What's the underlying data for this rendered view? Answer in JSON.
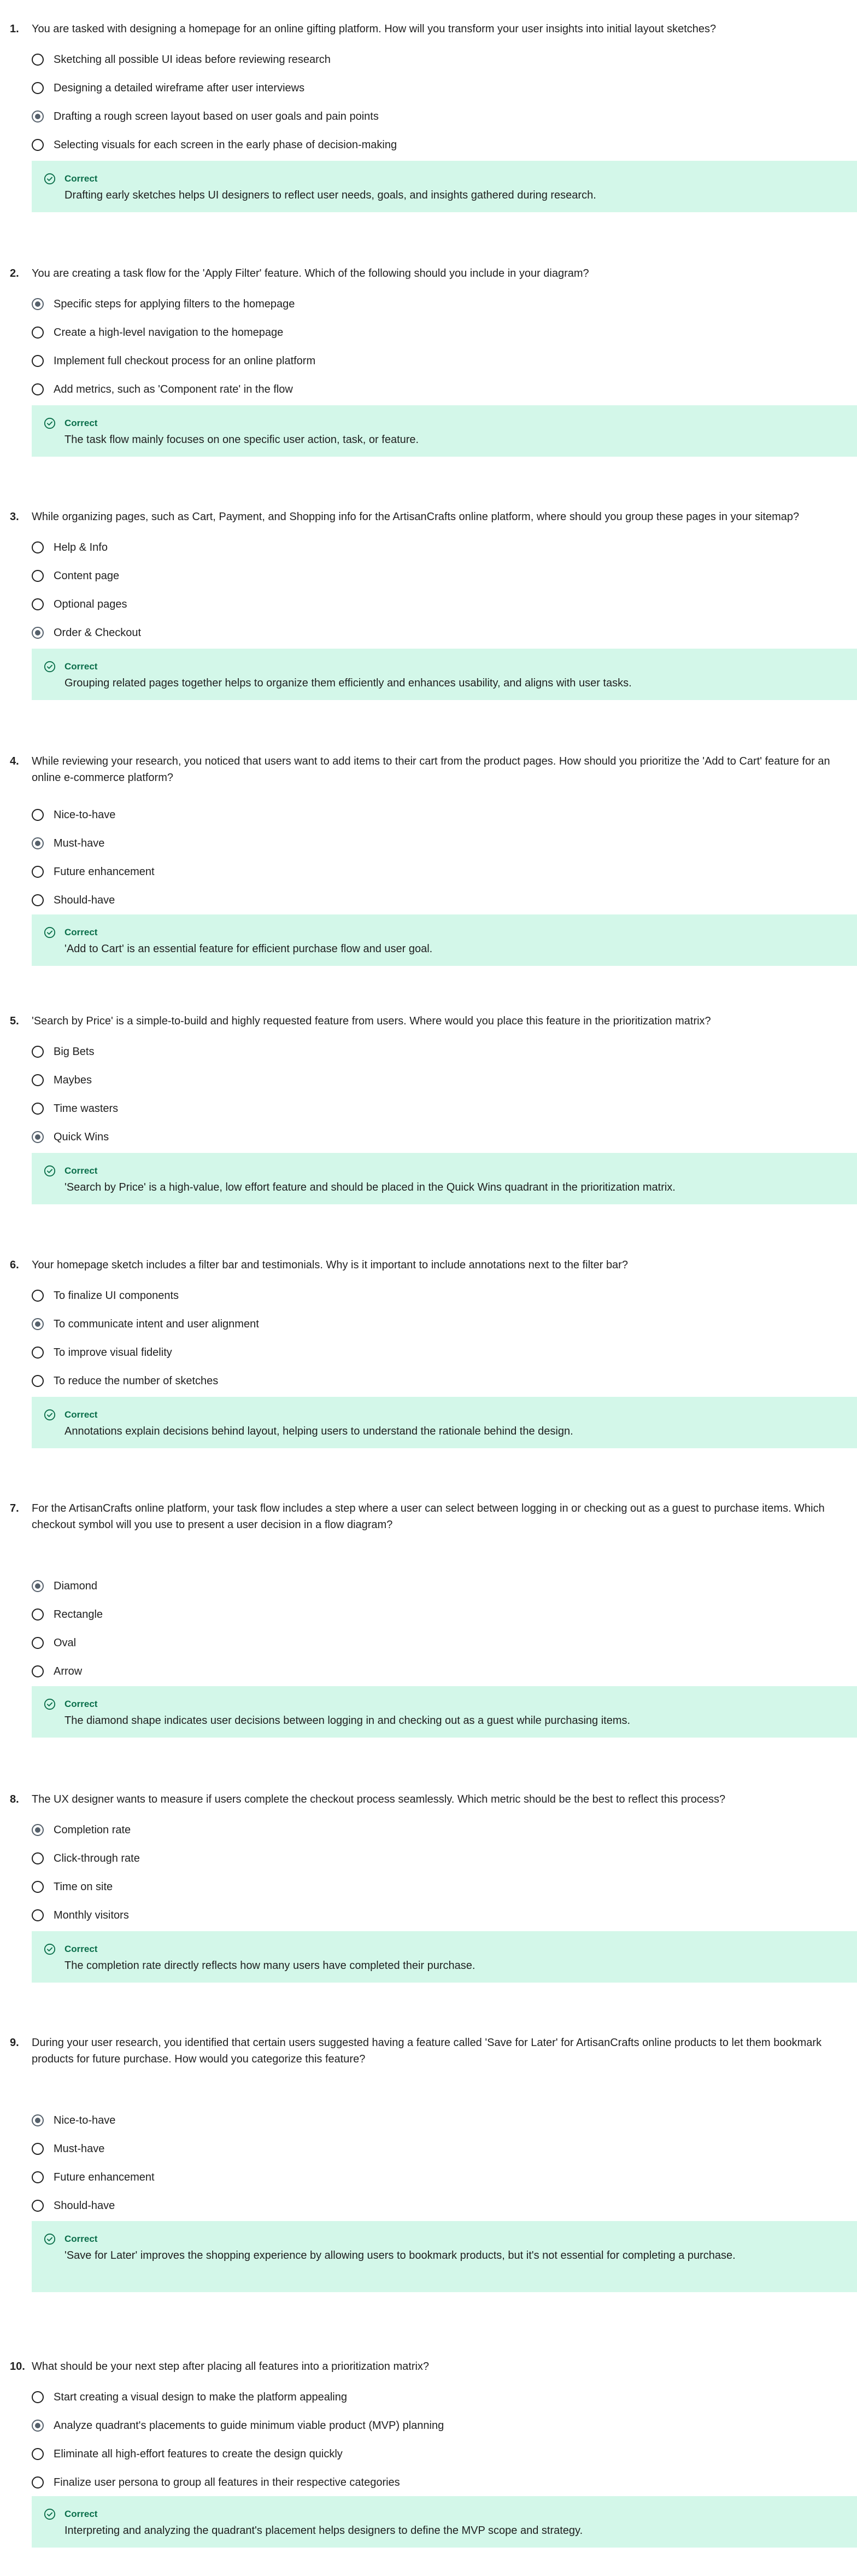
{
  "status_label": "Correct",
  "colors": {
    "feedback_bg": "#d3f7e9",
    "correct_text": "#0a6e4a",
    "selected_radio": "#55606b"
  },
  "icons": {
    "feedback": "check-circle-icon"
  },
  "questions": [
    {
      "number": "1.",
      "text": "You are tasked with designing a homepage for an online gifting platform. How will you transform your user insights into initial layout sketches?",
      "options": [
        "Sketching all possible UI ideas before reviewing research",
        "Designing a detailed wireframe after user interviews",
        "Drafting a rough screen layout based on user goals and pain points",
        "Selecting visuals for each screen in the early phase of decision-making"
      ],
      "selected_index": 2,
      "feedback": "Drafting early sketches helps UI designers to reflect user needs, goals, and insights gathered during research."
    },
    {
      "number": "2.",
      "text": "You are creating a task flow for the 'Apply Filter' feature. Which of the following should you include in your diagram?",
      "options": [
        "Specific steps for applying filters to the homepage",
        "Create a high-level navigation to the homepage",
        "Implement full checkout process for an online platform",
        "Add metrics, such as 'Component rate' in the flow"
      ],
      "selected_index": 0,
      "feedback": "The task flow mainly focuses on one specific user action, task, or feature."
    },
    {
      "number": "3.",
      "text": "While organizing pages, such as Cart, Payment, and Shopping info for the ArtisanCrafts online platform, where should you group these pages in your sitemap?",
      "options": [
        "Help & Info",
        "Content page",
        "Optional pages",
        "Order & Checkout"
      ],
      "selected_index": 3,
      "feedback": "Grouping related pages together helps to organize them efficiently and enhances usability, and aligns with user tasks."
    },
    {
      "number": "4.",
      "text": "While reviewing your research, you noticed that users want to add items to their cart from the product pages. How should you prioritize the 'Add to Cart' feature for an online e-commerce platform?",
      "options": [
        "Nice-to-have",
        "Must-have",
        "Future enhancement",
        "Should-have"
      ],
      "selected_index": 1,
      "feedback": "'Add to Cart' is an essential feature for efficient purchase flow and user goal."
    },
    {
      "number": "5.",
      "text": "'Search by Price' is a simple-to-build and highly requested feature from users. Where would you place this feature in the prioritization matrix?",
      "options": [
        "Big Bets",
        "Maybes",
        "Time wasters",
        "Quick Wins"
      ],
      "selected_index": 3,
      "feedback": "'Search by Price' is a high-value, low effort feature and should be placed in the Quick Wins quadrant in the prioritization matrix."
    },
    {
      "number": "6.",
      "text": "Your homepage sketch includes a filter bar and testimonials. Why is it important to include annotations next to the filter bar?",
      "options": [
        "To finalize UI components",
        "To communicate intent and user alignment",
        "To improve visual fidelity",
        "To reduce the number of sketches"
      ],
      "selected_index": 1,
      "feedback": "Annotations explain decisions behind layout, helping users to understand the rationale behind the design."
    },
    {
      "number": "7.",
      "text": "For the ArtisanCrafts online platform, your task flow includes a step where a user can select between logging in or checking out as a guest to purchase items. Which checkout symbol will you use to present a user decision in a flow diagram?",
      "options": [
        "Diamond",
        "Rectangle",
        "Oval",
        "Arrow"
      ],
      "selected_index": 0,
      "feedback": "The diamond shape indicates user decisions between logging in and checking out as a guest while purchasing items."
    },
    {
      "number": "8.",
      "text": "The UX designer wants to measure if users complete the checkout process seamlessly. Which metric should be the best to reflect this process?",
      "options": [
        "Completion rate",
        "Click-through rate",
        "Time on site",
        "Monthly visitors"
      ],
      "selected_index": 0,
      "feedback": "The completion rate directly reflects how many users have completed their purchase."
    },
    {
      "number": "9.",
      "text": "During your user research, you identified that certain users suggested having a feature called 'Save for Later' for ArtisanCrafts online products to let them bookmark products for future purchase. How would you categorize this feature?",
      "options": [
        "Nice-to-have",
        "Must-have",
        "Future enhancement",
        "Should-have"
      ],
      "selected_index": 0,
      "feedback": "'Save for Later' improves the shopping experience by allowing users to bookmark products, but it's not essential for completing a purchase."
    },
    {
      "number": "10.",
      "text": "What should be your next step after placing all features into a prioritization matrix?",
      "options": [
        "Start creating a visual design to make the platform appealing",
        "Analyze quadrant's placements to guide minimum viable product (MVP) planning",
        "Eliminate all high-effort features to create the design quickly",
        "Finalize user persona to group all features in their respective categories"
      ],
      "selected_index": 1,
      "feedback": "Interpreting and analyzing the quadrant's placement helps designers to define the MVP scope and strategy."
    }
  ]
}
